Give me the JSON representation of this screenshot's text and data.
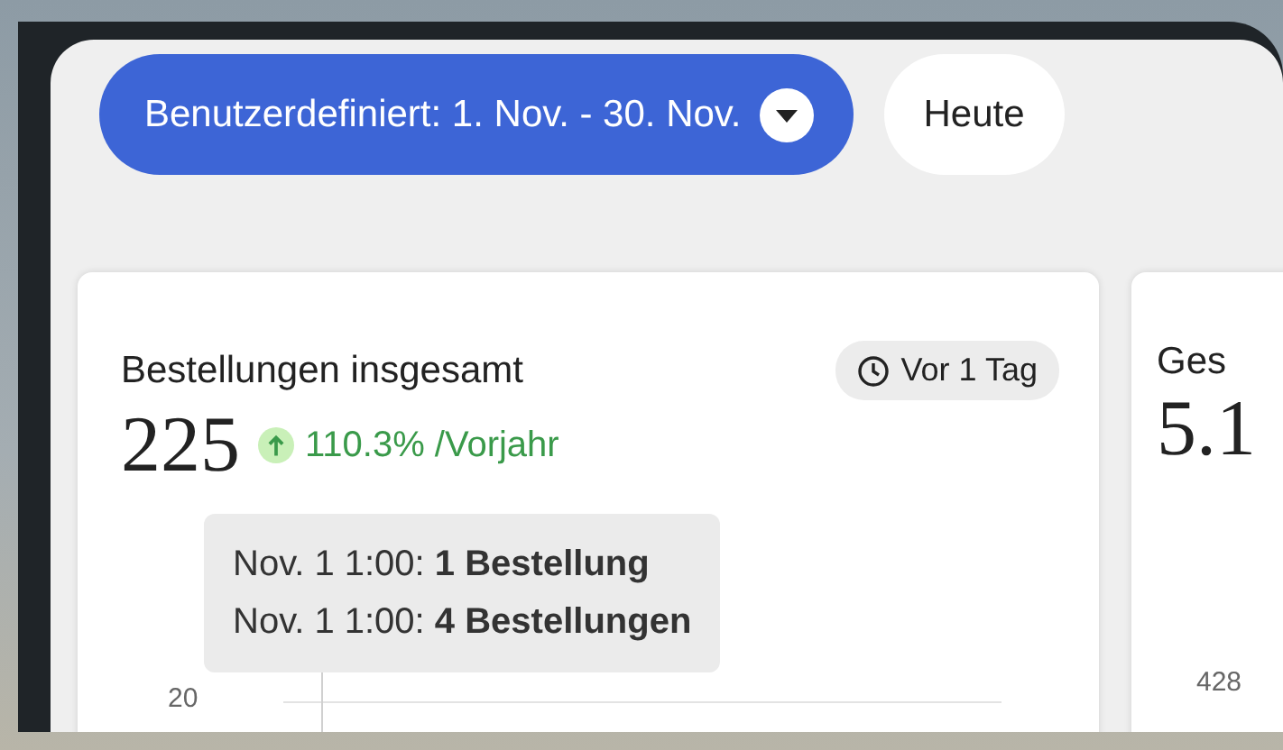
{
  "date_range": {
    "label": "Benutzerdefiniert: 1. Nov. - 30. Nov."
  },
  "today_button": {
    "label": "Heute"
  },
  "cards": [
    {
      "title": "Bestellungen insgesamt",
      "updated": "Vor 1 Tag",
      "value": "225",
      "change": {
        "up": true,
        "text": "110.3% /Vorjahr"
      },
      "chart": {
        "y_tick": "20",
        "tooltip": [
          "Nov. 1 1:00: **1 Bestellung**",
          "Nov. 1 1:00: **4 Bestellungen**"
        ]
      }
    },
    {
      "title": "Ges",
      "value": "5.1",
      "chart": {
        "y_tick": "428"
      }
    }
  ]
}
